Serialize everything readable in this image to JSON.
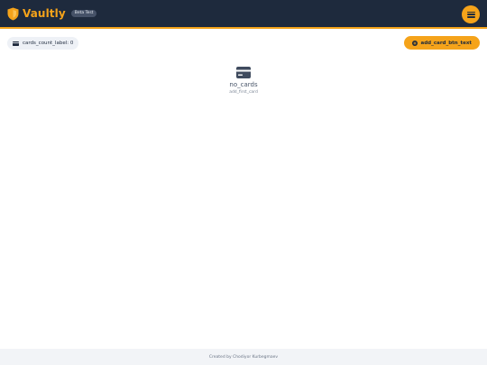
{
  "header": {
    "brand": "Vaultly",
    "beta_badge": "Beta Test",
    "logo_icon": "shield-icon",
    "menu_icon": "hamburger-icon"
  },
  "toolbar": {
    "count_label": "cards_count_label",
    "count_value": "0",
    "count_icon": "card-icon",
    "add_button_label": "add_card_btn_text",
    "add_button_icon": "plus-circle-icon"
  },
  "empty_state": {
    "icon": "credit-card-icon",
    "title": "no_cards",
    "subtitle": "add_first_card"
  },
  "footer": {
    "credit": "Created by Chodiyor Kurbegmaev"
  },
  "colors": {
    "header_bg": "#1e2a3d",
    "accent": "#f5a31a",
    "footer_bg": "#f2f4f7",
    "chip_bg": "#eef1f6"
  }
}
